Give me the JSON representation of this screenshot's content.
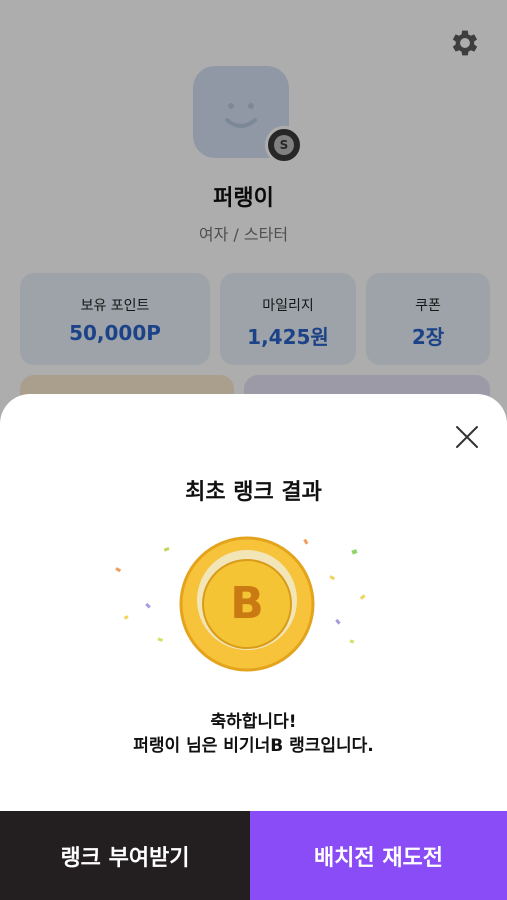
{
  "profile": {
    "nickname": "퍼랭이",
    "subinfo": "여자 / 스타터",
    "stats": [
      {
        "label": "보유 포인트",
        "value": "50,000P"
      },
      {
        "label": "마일리지",
        "value": "1,425원"
      },
      {
        "label": "쿠폰",
        "value": "2장"
      }
    ],
    "badge_letter": "S"
  },
  "modal": {
    "title": "최초 랭크 결과",
    "rank_letter": "B",
    "message_line1": "축하합니다!",
    "message_line2": "퍼랭이 님은 비기너B 랭크입니다.",
    "accept_label": "랭크 부여받기",
    "retry_label": "배치전 재도전"
  },
  "colors": {
    "accent_purple": "#8a4cf7",
    "dark_button": "#231f20",
    "stat_value_blue": "#2a63c7",
    "coin_gold": "#f6c33a"
  },
  "icons": {
    "settings": "gear-icon",
    "close": "close-icon"
  }
}
